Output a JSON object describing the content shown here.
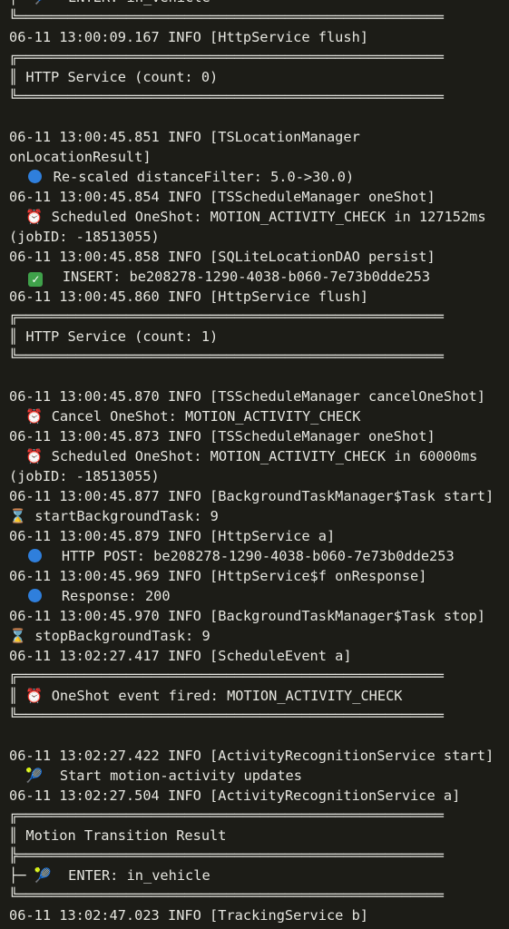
{
  "colors": {
    "background": "#1c1c17",
    "text": "#e6e6e0",
    "info_dot": "#2f7fdc",
    "check": "#3fa14a",
    "alarm_clock": "#e5483a"
  },
  "lines": {
    "l01": "├─ 🎾  ENTER: in_vehicle",
    "l02": "╚═══════════════════════════════════════════════════",
    "l03": "06-11 13:00:09.167 INFO [HttpService flush]",
    "l04": "╔═══════════════════════════════════════════════════",
    "l05": "║ HTTP Service (count: 0)",
    "l06": "╚═══════════════════════════════════════════════════",
    "l07": "06-11 13:00:45.851 INFO [TSLocationManager",
    "l08": "onLocationResult]",
    "l09": "Re-scaled distanceFilter: 5.0->30.0)",
    "l10": "06-11 13:00:45.854 INFO [TSScheduleManager oneShot]",
    "l11": "Scheduled OneShot: MOTION_ACTIVITY_CHECK in 127152ms",
    "l12": "(jobID: -18513055)",
    "l13": "06-11 13:00:45.858 INFO [SQLiteLocationDAO persist]",
    "l14": "INSERT: be208278-1290-4038-b060-7e73b0dde253",
    "l15": "06-11 13:00:45.860 INFO [HttpService flush]",
    "l16": "╔═══════════════════════════════════════════════════",
    "l17": "║ HTTP Service (count: 1)",
    "l18": "╚═══════════════════════════════════════════════════",
    "l19": "06-11 13:00:45.870 INFO [TSScheduleManager cancelOneShot]",
    "l20": "Cancel OneShot: MOTION_ACTIVITY_CHECK",
    "l21": "06-11 13:00:45.873 INFO [TSScheduleManager oneShot]",
    "l22": "Scheduled OneShot: MOTION_ACTIVITY_CHECK in 60000ms",
    "l23": "(jobID: -18513055)",
    "l24": "06-11 13:00:45.877 INFO [BackgroundTaskManager$Task start]",
    "l25": "startBackgroundTask: 9",
    "l26": "06-11 13:00:45.879 INFO [HttpService a]",
    "l27": "HTTP POST: be208278-1290-4038-b060-7e73b0dde253",
    "l28": "06-11 13:00:45.969 INFO [HttpService$f onResponse]",
    "l29": "Response: 200",
    "l30": "06-11 13:00:45.970 INFO [BackgroundTaskManager$Task stop]",
    "l31": "stopBackgroundTask: 9",
    "l32": "06-11 13:02:27.417 INFO [ScheduleEvent a]",
    "l33": "╔═══════════════════════════════════════════════════",
    "l34": "OneShot event fired: MOTION_ACTIVITY_CHECK",
    "l35": "╚═══════════════════════════════════════════════════",
    "l36": "06-11 13:02:27.422 INFO [ActivityRecognitionService start]",
    "l37": "Start motion-activity updates",
    "l38": "06-11 13:02:27.504 INFO [ActivityRecognitionService a]",
    "l39": "╔═══════════════════════════════════════════════════",
    "l40": "║ Motion Transition Result",
    "l41": "╠═══════════════════════════════════════════════════",
    "l42": "ENTER: in_vehicle",
    "l43": "╚═══════════════════════════════════════════════════",
    "l44": "06-11 13:02:47.023 INFO [TrackingService b]"
  }
}
